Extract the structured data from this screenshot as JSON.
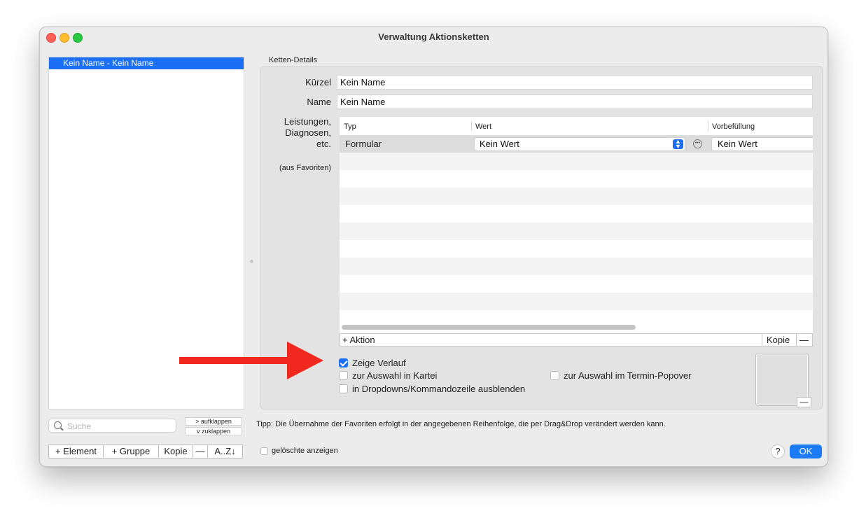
{
  "window": {
    "title": "Verwaltung Aktionsketten"
  },
  "list": {
    "items": [
      "Kein Name - Kein Name"
    ]
  },
  "search": {
    "placeholder": "Suche"
  },
  "tree": {
    "expand_label": "> aufklappen",
    "collapse_label": "v  zuklappen"
  },
  "left_toolbar": {
    "add_element": "+ Element",
    "add_group": "+ Gruppe",
    "copy": "Kopie",
    "remove": "—",
    "sort": "A..Z↓"
  },
  "details": {
    "group_label": "Ketten-Details",
    "kuerzel_label": "Kürzel",
    "kuerzel_value": "Kein Name",
    "name_label": "Name",
    "name_value": "Kein Name",
    "services_label_1": "Leistungen,",
    "services_label_2": "Diagnosen,",
    "services_label_3": "etc.",
    "favorites_note": "(aus Favoriten)"
  },
  "table": {
    "columns": [
      "Typ",
      "Wert",
      "Vorbefüllung"
    ],
    "rows": [
      {
        "typ": "Formular",
        "wert": "Kein Wert",
        "vorbefuellung": "Kein Wert"
      }
    ]
  },
  "table_toolbar": {
    "add_action": "+ Aktion",
    "copy": "Kopie",
    "remove": "—"
  },
  "options": {
    "show_history": {
      "label": "Zeige Verlauf",
      "checked": true
    },
    "select_in_kartei": {
      "label": "zur Auswahl in Kartei",
      "checked": false
    },
    "select_in_termin": {
      "label": "zur Auswahl im Termin-Popover",
      "checked": false
    },
    "hide_in_dropdowns": {
      "label": "in Dropdowns/Kommandozeile ausblenden",
      "checked": false
    }
  },
  "preview": {
    "remove": "—"
  },
  "tip": "Tipp: Die Übernahme der Favoriten erfolgt in der angegebenen Reihenfolge, die per Drag&Drop verändert werden kann.",
  "footer": {
    "show_deleted": {
      "label": "gelöschte anzeigen",
      "checked": false
    },
    "help": "?",
    "ok": "OK"
  },
  "colors": {
    "accent": "#1a6ff5",
    "arrow": "#f0281e",
    "close": "#fe5f57",
    "minimize": "#febc2e",
    "maximize": "#28c840"
  }
}
